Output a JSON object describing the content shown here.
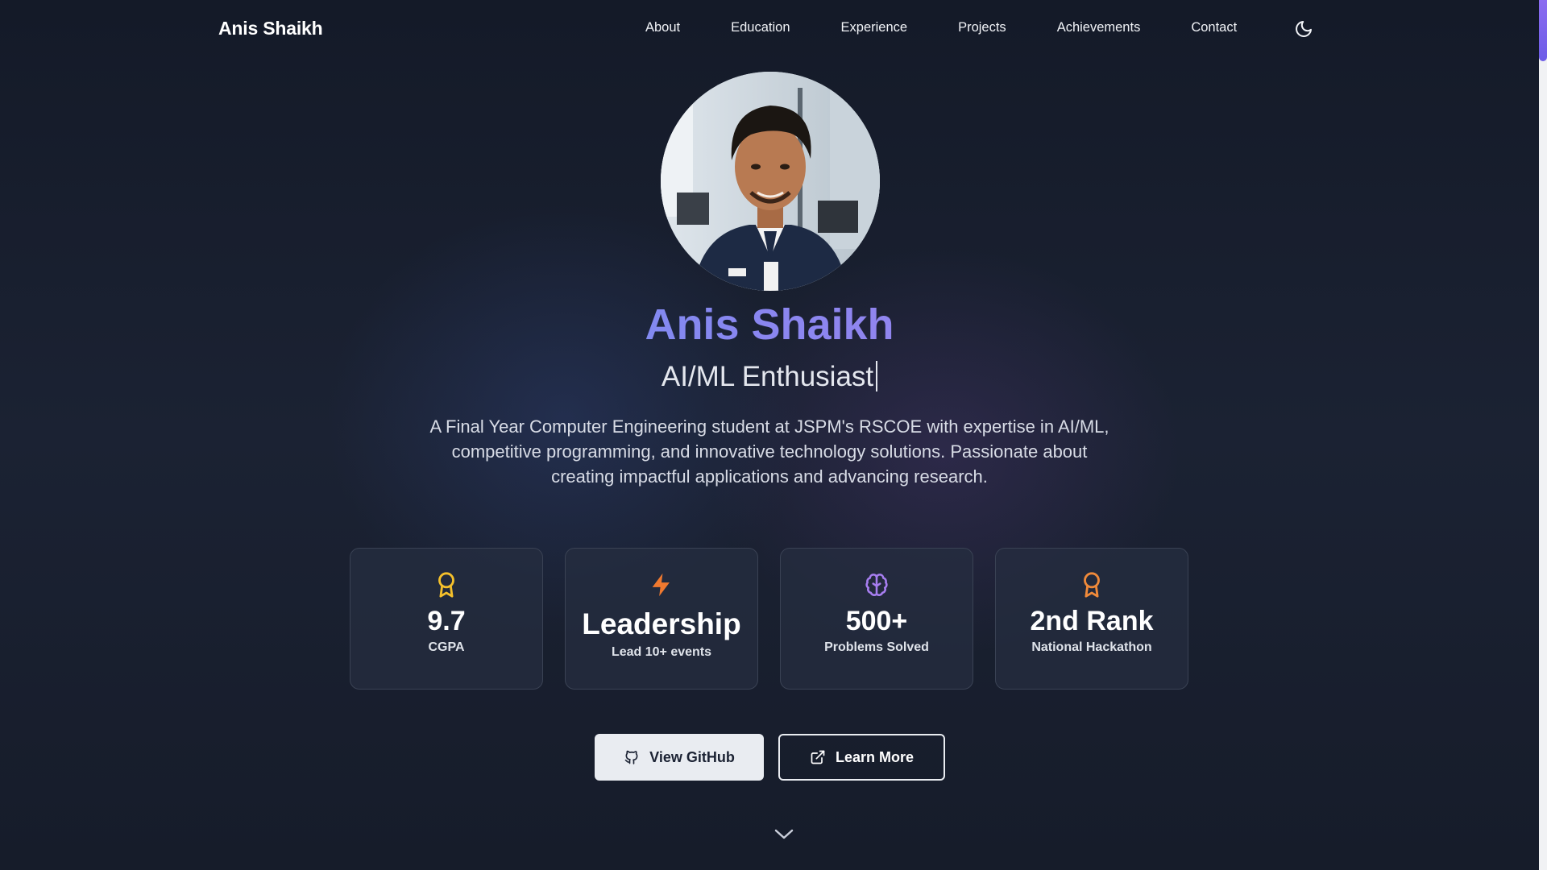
{
  "nav": {
    "brand": "Anis Shaikh",
    "links": [
      {
        "label": "About"
      },
      {
        "label": "Education"
      },
      {
        "label": "Experience"
      },
      {
        "label": "Projects"
      },
      {
        "label": "Achievements"
      },
      {
        "label": "Contact"
      }
    ],
    "theme_icon": "moon-icon"
  },
  "hero": {
    "name": "Anis Shaikh",
    "role": "AI/ML Enthusiast",
    "description": "A Final Year Computer Engineering student at JSPM's RSCOE with expertise in AI/ML, competitive programming, and innovative technology solutions. Passionate about creating impactful applications and advancing research."
  },
  "stats": [
    {
      "icon": "award-icon",
      "icon_color": "#f5c02b",
      "value": "9.7",
      "label": "CGPA"
    },
    {
      "icon": "lightning-icon",
      "icon_color": "#f0792f",
      "value": "Leadership",
      "label": "Lead 10+ events"
    },
    {
      "icon": "brain-icon",
      "icon_color": "#a77ef0",
      "value": "500+",
      "label": "Problems Solved"
    },
    {
      "icon": "award-icon",
      "icon_color": "#f08a3a",
      "value": "2nd Rank",
      "label": "National Hackathon"
    }
  ],
  "buttons": {
    "github": "View GitHub",
    "learn_more": "Learn More"
  },
  "colors": {
    "gradient_start": "#5a9cf5",
    "gradient_end": "#b47ee8",
    "background": "#161c2b"
  }
}
